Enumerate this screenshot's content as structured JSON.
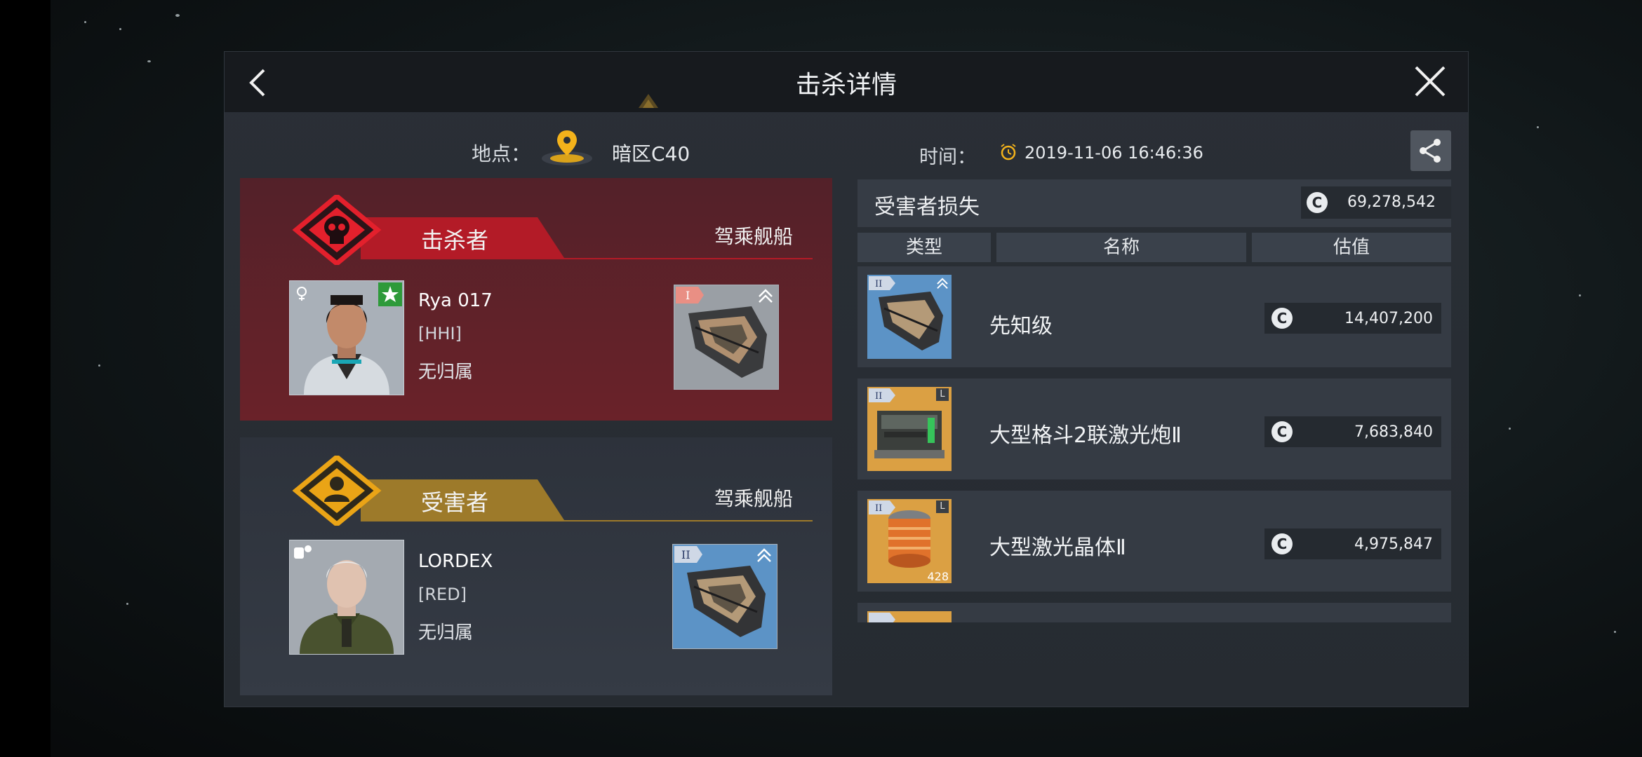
{
  "header": {
    "title": "击杀详情",
    "back_icon": "back-chevron-icon",
    "close_icon": "close-icon"
  },
  "info": {
    "location_label": "地点：",
    "location_value": "暗区C40",
    "time_label": "时间：",
    "time_value": "2019-11-06 16:46:36",
    "share_icon": "share-icon"
  },
  "killer": {
    "section_label": "击杀者",
    "ship_label": "驾乘舰船",
    "name": "Rya 017",
    "corp": "[HHI]",
    "alliance": "无归属",
    "ship_tier": "I",
    "color": "#d8202b"
  },
  "victim": {
    "section_label": "受害者",
    "ship_label": "驾乘舰船",
    "name": "LORDEX",
    "corp": "[RED]",
    "alliance": "无归属",
    "ship_tier": "II",
    "color": "#e8a114"
  },
  "losses": {
    "title": "受害者损失",
    "total": "69,278,542",
    "columns": [
      "类型",
      "名称",
      "估值"
    ],
    "currency_symbol": "C",
    "items": [
      {
        "name": "先知级",
        "value": "14,407,200",
        "tier": "II",
        "quantity": ""
      },
      {
        "name": "大型格斗2联激光炮Ⅱ",
        "value": "7,683,840",
        "tier": "II",
        "slot": "L",
        "quantity": ""
      },
      {
        "name": "大型激光晶体Ⅱ",
        "value": "4,975,847",
        "tier": "II",
        "slot": "L",
        "quantity": "428"
      }
    ]
  }
}
